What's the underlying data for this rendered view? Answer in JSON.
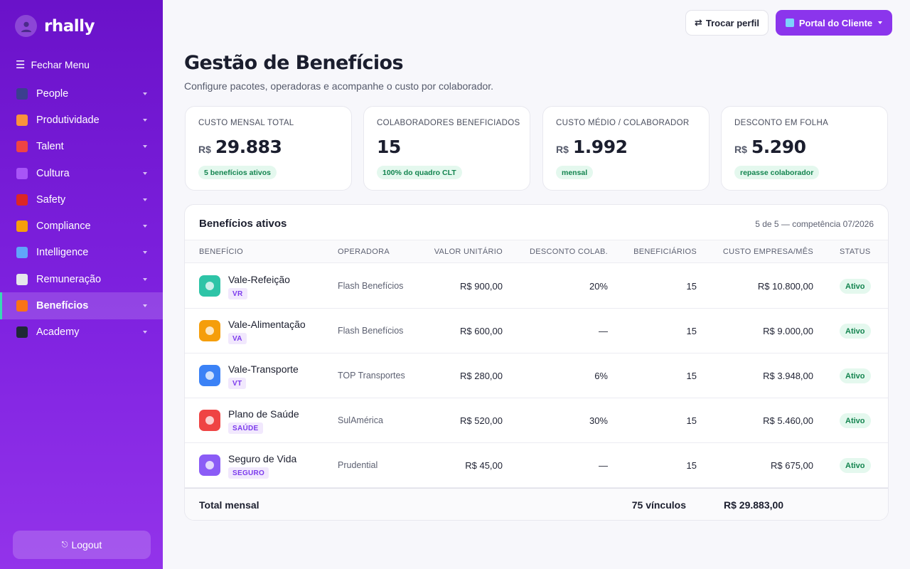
{
  "brand": {
    "name": "rhally"
  },
  "sidebar": {
    "toggle_label": "Fechar Menu",
    "items": [
      {
        "label": "People",
        "icon": "people-icon",
        "color": "#3b3f8f"
      },
      {
        "label": "Produtividade",
        "icon": "alarm-clock-icon",
        "color": "#fb923c"
      },
      {
        "label": "Talent",
        "icon": "target-icon",
        "color": "#ef4444"
      },
      {
        "label": "Cultura",
        "icon": "purple-heart-icon",
        "color": "#a855f7"
      },
      {
        "label": "Safety",
        "icon": "helmet-icon",
        "color": "#dc2626"
      },
      {
        "label": "Compliance",
        "icon": "scales-icon",
        "color": "#f59e0b"
      },
      {
        "label": "Intelligence",
        "icon": "bar-chart-icon",
        "color": "#60a5fa"
      },
      {
        "label": "Remuneração",
        "icon": "receipt-icon",
        "color": "#e5e7eb"
      },
      {
        "label": "Benefícios",
        "icon": "gift-icon",
        "color": "#f97316",
        "active": true
      },
      {
        "label": "Academy",
        "icon": "graduation-cap-icon",
        "color": "#1f2937"
      }
    ],
    "logout_label": "Logout"
  },
  "header": {
    "switch_profile_label": "Trocar perfil",
    "portal_label": "Portal do Cliente"
  },
  "page": {
    "title": "Gestão de Benefícios",
    "subtitle": "Configure pacotes, operadoras e acompanhe o custo por colaborador."
  },
  "stats": [
    {
      "label": "CUSTO MENSAL TOTAL",
      "currency": "R$",
      "value": "29.883",
      "badge": "5 benefícios ativos"
    },
    {
      "label": "COLABORADORES BENEFICIADOS",
      "currency": "",
      "value": "15",
      "badge": "100% do quadro CLT"
    },
    {
      "label": "CUSTO MÉDIO / COLABORADOR",
      "currency": "R$",
      "value": "1.992",
      "badge": "mensal"
    },
    {
      "label": "DESCONTO EM FOLHA",
      "currency": "R$",
      "value": "5.290",
      "badge": "repasse colaborador"
    }
  ],
  "table": {
    "title": "Benefícios ativos",
    "meta": "5 de 5 — competência 07/2026",
    "columns": [
      "BENEFÍCIO",
      "OPERADORA",
      "VALOR UNITÁRIO",
      "DESCONTO COLAB.",
      "BENEFICIÁRIOS",
      "CUSTO EMPRESA/MÊS",
      "STATUS"
    ],
    "rows": [
      {
        "name": "Vale-Refeição",
        "tag": "VR",
        "operator": "Flash Benefícios",
        "unit": "R$ 900,00",
        "discount": "20%",
        "count": "15",
        "cost": "R$ 10.800,00",
        "status": "Ativo",
        "icon": "plate-icon",
        "color": "#2ec4a7"
      },
      {
        "name": "Vale-Alimentação",
        "tag": "VA",
        "operator": "Flash Benefícios",
        "unit": "R$ 600,00",
        "discount": "—",
        "count": "15",
        "cost": "R$ 9.000,00",
        "status": "Ativo",
        "icon": "shopping-cart-icon",
        "color": "#f59e0b"
      },
      {
        "name": "Vale-Transporte",
        "tag": "VT",
        "operator": "TOP Transportes",
        "unit": "R$ 280,00",
        "discount": "6%",
        "count": "15",
        "cost": "R$ 3.948,00",
        "status": "Ativo",
        "icon": "bus-icon",
        "color": "#3b82f6"
      },
      {
        "name": "Plano de Saúde",
        "tag": "SAÚDE",
        "operator": "SulAmérica",
        "unit": "R$ 520,00",
        "discount": "30%",
        "count": "15",
        "cost": "R$ 5.460,00",
        "status": "Ativo",
        "icon": "stethoscope-icon",
        "color": "#ef4444"
      },
      {
        "name": "Seguro de Vida",
        "tag": "SEGURO",
        "operator": "Prudential",
        "unit": "R$ 45,00",
        "discount": "—",
        "count": "15",
        "cost": "R$ 675,00",
        "status": "Ativo",
        "icon": "shield-icon",
        "color": "#8b5cf6"
      }
    ],
    "footer": {
      "label": "Total mensal",
      "links": "75 vínculos",
      "total": "R$ 29.883,00"
    }
  }
}
